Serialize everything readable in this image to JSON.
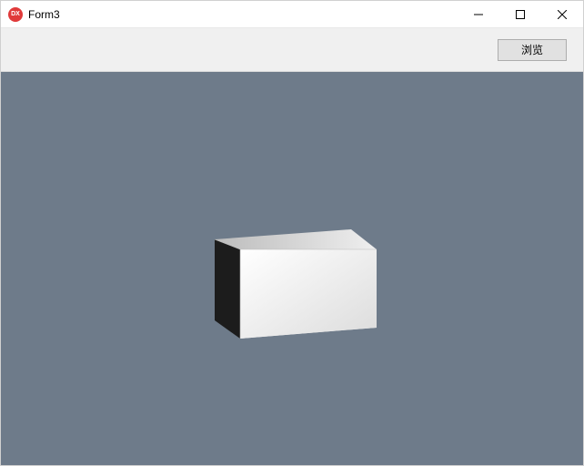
{
  "titlebar": {
    "app_icon_label": "DX",
    "title": "Form3"
  },
  "toolbar": {
    "browse_label": "浏览"
  },
  "viewport": {
    "object": "3d-box"
  }
}
